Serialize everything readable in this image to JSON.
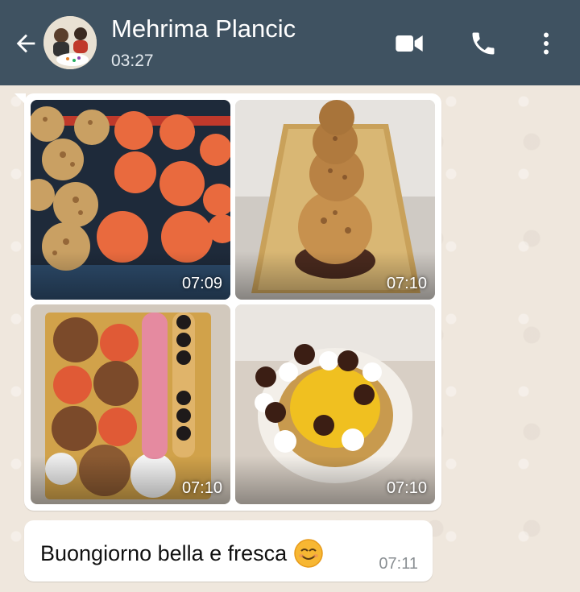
{
  "header": {
    "contact_name": "Mehrima Plancic",
    "status": "03:27",
    "color": "#3f5261",
    "icons": [
      "back-arrow-icon",
      "video-call-icon",
      "phone-icon",
      "more-options-icon"
    ]
  },
  "messages": {
    "images": [
      {
        "time": "07:09",
        "subject": "choux-pastries-on-tray"
      },
      {
        "time": "07:10",
        "subject": "choux-tower-on-gold-platter"
      },
      {
        "time": "07:10",
        "subject": "pastry-assortment-with-eclairs"
      },
      {
        "time": "07:10",
        "subject": "saint-honore-cake"
      }
    ],
    "text": {
      "body": "Buongiorno bella e fresca",
      "emoji": "smiling-face-icon",
      "time": "07:11"
    }
  }
}
